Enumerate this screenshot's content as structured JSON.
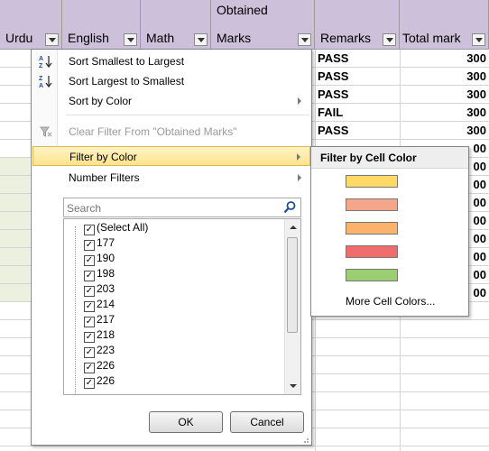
{
  "headers": {
    "urdu": "Urdu",
    "english": "English",
    "math": "Math",
    "obtained_line1": "Obtained",
    "obtained_line2": "Marks",
    "remarks": "Remarks",
    "total": "Total mark"
  },
  "rows": [
    {
      "remark": "PASS",
      "total": "300"
    },
    {
      "remark": "PASS",
      "total": "300"
    },
    {
      "remark": "PASS",
      "total": "300"
    },
    {
      "remark": "FAIL",
      "total": "300"
    },
    {
      "remark": "PASS",
      "total": "300"
    },
    {
      "remark": "",
      "total": "00"
    },
    {
      "remark": "",
      "total": "00"
    },
    {
      "remark": "",
      "total": "00"
    },
    {
      "remark": "",
      "total": "00"
    },
    {
      "remark": "",
      "total": "00"
    },
    {
      "remark": "",
      "total": "00"
    },
    {
      "remark": "",
      "total": "00"
    },
    {
      "remark": "",
      "total": "00"
    },
    {
      "remark": "",
      "total": "00"
    }
  ],
  "menu": {
    "sort_asc": "Sort Smallest to Largest",
    "sort_desc": "Sort Largest to Smallest",
    "sort_color": "Sort by Color",
    "clear_filter": "Clear Filter From \"Obtained Marks\"",
    "filter_color": "Filter by Color",
    "number_filters": "Number Filters",
    "search_placeholder": "Search",
    "select_all": "(Select All)",
    "values": [
      "177",
      "190",
      "198",
      "203",
      "214",
      "217",
      "218",
      "223",
      "226"
    ],
    "partial_value": "226",
    "ok": "OK",
    "cancel": "Cancel"
  },
  "submenu": {
    "title": "Filter by Cell Color",
    "colors": [
      "#ffd966",
      "#f4a58a",
      "#fbb26a",
      "#f06c6c",
      "#9bce72"
    ],
    "more": "More Cell Colors..."
  },
  "colors": {
    "header_bg": "#ccc0da",
    "green_fill": "#ebf1de",
    "highlight": "#ffe38c"
  }
}
